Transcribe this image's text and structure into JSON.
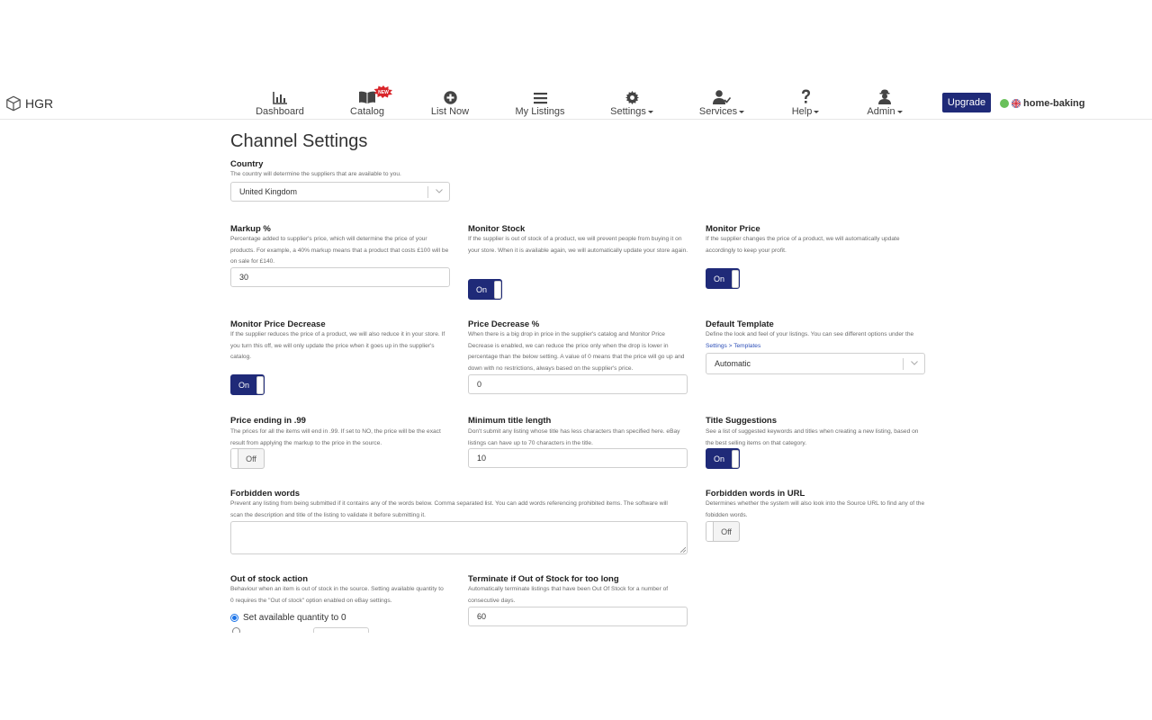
{
  "brand": {
    "name": "HGR"
  },
  "nav": [
    {
      "id": "dashboard",
      "label": "Dashboard",
      "icon": "bar-chart-icon"
    },
    {
      "id": "catalog",
      "label": "Catalog",
      "icon": "book-icon",
      "badge": "NEW"
    },
    {
      "id": "list-now",
      "label": "List Now",
      "icon": "plus-circle-icon"
    },
    {
      "id": "my-listings",
      "label": "My Listings",
      "icon": "list-icon"
    },
    {
      "id": "settings",
      "label": "Settings",
      "icon": "gear-icon",
      "dropdown": true
    },
    {
      "id": "services",
      "label": "Services",
      "icon": "user-check-icon",
      "dropdown": true
    },
    {
      "id": "help",
      "label": "Help",
      "icon": "question-icon",
      "dropdown": true
    },
    {
      "id": "admin",
      "label": "Admin",
      "icon": "admin-icon",
      "dropdown": true
    }
  ],
  "upgrade_label": "Upgrade",
  "store_name": "home-baking",
  "page_title": "Channel Settings",
  "country": {
    "title": "Country",
    "desc": "The country will determine the suppliers that are available to you.",
    "value": "United Kingdom"
  },
  "markup": {
    "title": "Markup %",
    "desc": "Percentage added to supplier's price, which will determine the price of your products. For example, a 40% markup means that a product that costs £100 will be on sale for £140.",
    "value": "30"
  },
  "monitor_stock": {
    "title": "Monitor Stock",
    "desc": "If the supplier is out of stock of a product, we will prevent people from buying it on your store. When it is available again, we will automatically update your store again.",
    "state": "On"
  },
  "monitor_price": {
    "title": "Monitor Price",
    "desc": "If the supplier changes the price of a product, we will automatically update accordingly to keep your profit.",
    "state": "On"
  },
  "monitor_price_decrease": {
    "title": "Monitor Price Decrease",
    "desc": "If the supplier reduces the price of a product, we will also reduce it in your store. If you turn this off, we will only update the price when it goes up in the supplier's catalog.",
    "state": "On"
  },
  "price_decrease": {
    "title": "Price Decrease %",
    "desc": "When there is a big drop in price in the supplier's catalog and Monitor Price Decrease is enabled, we can reduce the price only when the drop is lower in percentage than the below setting. A value of 0 means that the price will go up and down with no restrictions, always based on the supplier's price.",
    "value": "0"
  },
  "default_template": {
    "title": "Default Template",
    "desc": "Define the look and feel of your listings. You can see different options under the",
    "link": "Settings > Templates",
    "value": "Automatic"
  },
  "price_ending": {
    "title": "Price ending in .99",
    "desc": "The prices for all the items will end in .99. If set to NO, the price will be the exact result from applying the markup to the price in the source.",
    "state": "Off"
  },
  "min_title": {
    "title": "Minimum title length",
    "desc": "Don't submit any listing whose title has less characters than specified here. eBay listings can have up to 70 characters in the title.",
    "value": "10"
  },
  "title_suggestions": {
    "title": "Title Suggestions",
    "desc": "See a list of suggested keywords and titles when creating a new listing, based on the best selling items on that category.",
    "state": "On"
  },
  "forbidden_words": {
    "title": "Forbidden words",
    "desc": "Prevent any listing from being submitted if it contains any of the words below. Comma separated list. You can add words referencing prohibited items. The software will scan the description and title of the listing to validate it before submitting it.",
    "value": ""
  },
  "forbidden_url": {
    "title": "Forbidden words in URL",
    "desc": "Determines whether the system will also look into the Source URL to find any of the fobidden words.",
    "state": "Off"
  },
  "out_of_stock_action": {
    "title": "Out of stock action",
    "desc": "Behaviour when an item is out of stock in the source. Setting available quantity to 0 requires the \"Out of stock\" option enabled on eBay settings.",
    "option1": "Set available quantity to 0"
  },
  "terminate": {
    "title": "Terminate if Out of Stock for too long",
    "desc": "Automatically terminate listings that have been Out Of Stock for a number of consecutive days.",
    "value": "60"
  },
  "colors": {
    "primary": "#1f2a78",
    "radio": "#1a73e8",
    "link": "#2d4fb8"
  }
}
